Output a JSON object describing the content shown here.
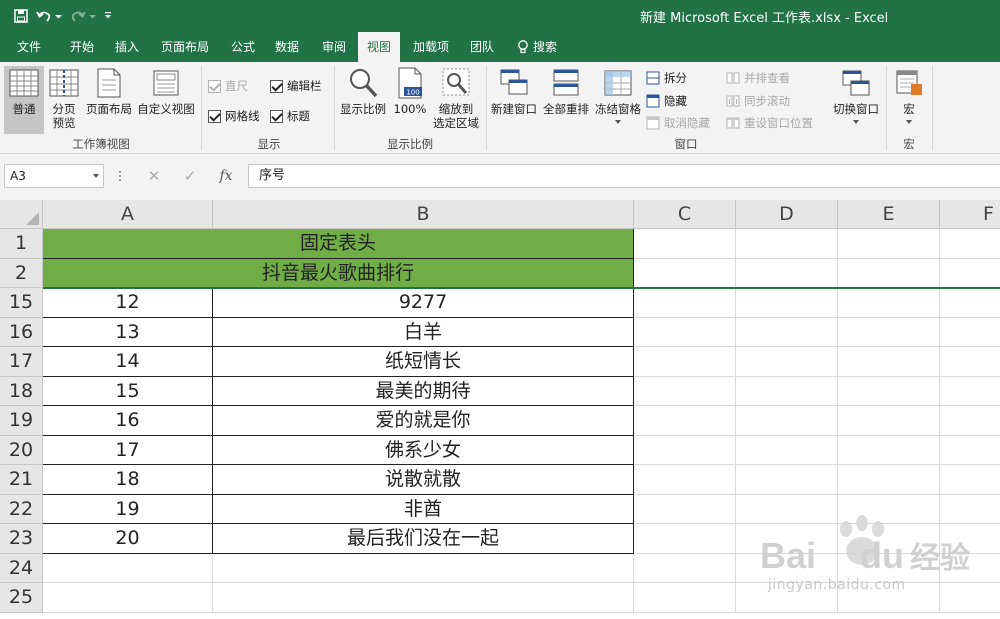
{
  "window": {
    "title": "新建 Microsoft Excel 工作表.xlsx  -  Excel"
  },
  "quick_access": {
    "save_icon": "save-icon",
    "undo_icon": "undo-icon",
    "redo_icon": "redo-icon",
    "customize_icon": "customize-icon"
  },
  "tabs": [
    {
      "label": "文件"
    },
    {
      "label": "开始"
    },
    {
      "label": "插入"
    },
    {
      "label": "页面布局"
    },
    {
      "label": "公式"
    },
    {
      "label": "数据"
    },
    {
      "label": "审阅"
    },
    {
      "label": "视图",
      "active": true
    },
    {
      "label": "加载项"
    },
    {
      "label": "团队"
    },
    {
      "label": "搜索"
    }
  ],
  "ribbon": {
    "workbook_views": {
      "group_label": "工作簿视图",
      "normal": "普通",
      "page_break": "分页\n预览",
      "page_layout": "页面布局",
      "custom_views": "自定义视图"
    },
    "show": {
      "group_label": "显示",
      "ruler": "直尺",
      "formula_bar": "编辑栏",
      "gridlines": "网格线",
      "headings": "标题"
    },
    "zoom": {
      "group_label": "显示比例",
      "zoom": "显示比例",
      "zoom_100": "100%",
      "zoom_100_badge": "100",
      "zoom_selection_line1": "缩放到",
      "zoom_selection_line2": "选定区域"
    },
    "window": {
      "group_label": "窗口",
      "new_window": "新建窗口",
      "arrange_all": "全部重排",
      "freeze_panes": "冻结窗格",
      "split": "拆分",
      "hide": "隐藏",
      "unhide": "取消隐藏",
      "side_by_side": "并排查看",
      "sync_scroll": "同步滚动",
      "reset_position": "重设窗口位置",
      "switch_windows": "切换窗口"
    },
    "macros": {
      "group_label": "宏",
      "macros": "宏"
    }
  },
  "formula_bar": {
    "name_box": "A3",
    "cancel_glyph": "✕",
    "enter_glyph": "✓",
    "fx_label": "fx",
    "content": "序号"
  },
  "sheet": {
    "columns": [
      "A",
      "B",
      "C",
      "D",
      "E",
      "F"
    ],
    "rows": [
      {
        "num": "1",
        "merged": "固定表头"
      },
      {
        "num": "2",
        "merged": "抖音最火歌曲排行"
      },
      {
        "num": "15",
        "a": "12",
        "b": "9277"
      },
      {
        "num": "16",
        "a": "13",
        "b": "白羊"
      },
      {
        "num": "17",
        "a": "14",
        "b": "纸短情长"
      },
      {
        "num": "18",
        "a": "15",
        "b": "最美的期待"
      },
      {
        "num": "19",
        "a": "16",
        "b": "爱的就是你"
      },
      {
        "num": "20",
        "a": "17",
        "b": "佛系少女"
      },
      {
        "num": "21",
        "a": "18",
        "b": "说散就散"
      },
      {
        "num": "22",
        "a": "19",
        "b": "非酋"
      },
      {
        "num": "23",
        "a": "20",
        "b": "最后我们没在一起"
      },
      {
        "num": "24",
        "a": "",
        "b": ""
      },
      {
        "num": "25",
        "a": "",
        "b": ""
      }
    ],
    "header_fill": "#70ad47"
  },
  "watermark": {
    "brand": "Bai",
    "brand2": "du",
    "cn": "经验",
    "url": "jingyan.baidu.com"
  },
  "colors": {
    "excel_green": "#217346",
    "header_fill": "#70ad47"
  }
}
